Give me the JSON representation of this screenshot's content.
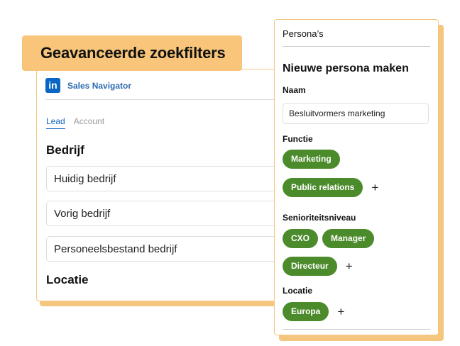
{
  "banner": {
    "title": "Geavanceerde zoekfilters"
  },
  "filters_card": {
    "brand": {
      "icon": "linkedin-icon",
      "icon_text": "in",
      "label": "Sales Navigator"
    },
    "tabs": [
      {
        "label": "Lead",
        "active": true
      },
      {
        "label": "Account",
        "active": false
      }
    ],
    "sections": {
      "company": {
        "heading": "Bedrijf",
        "fields": [
          "Huidig bedrijf",
          "Vorig bedrijf",
          "Personeelsbestand bedrijf"
        ]
      },
      "location": {
        "heading": "Locatie"
      }
    }
  },
  "persona_card": {
    "title": "Persona’s",
    "heading": "Nieuwe persona maken",
    "name_label": "Naam",
    "name_value": "Besluitvormers marketing",
    "function_label": "Functie",
    "functions": [
      "Marketing",
      "Public relations"
    ],
    "seniority_label": "Senioriteitsniveau",
    "seniorities": [
      "CXO",
      "Manager",
      "Directeur"
    ],
    "location_label": "Locatie",
    "locations": [
      "Europa"
    ],
    "add_symbol": "+"
  },
  "colors": {
    "accent_orange": "#f8c57a",
    "chip_green": "#4b8b2b",
    "linkedin_blue": "#0a66c2",
    "active_tab_blue": "#1565c0"
  }
}
